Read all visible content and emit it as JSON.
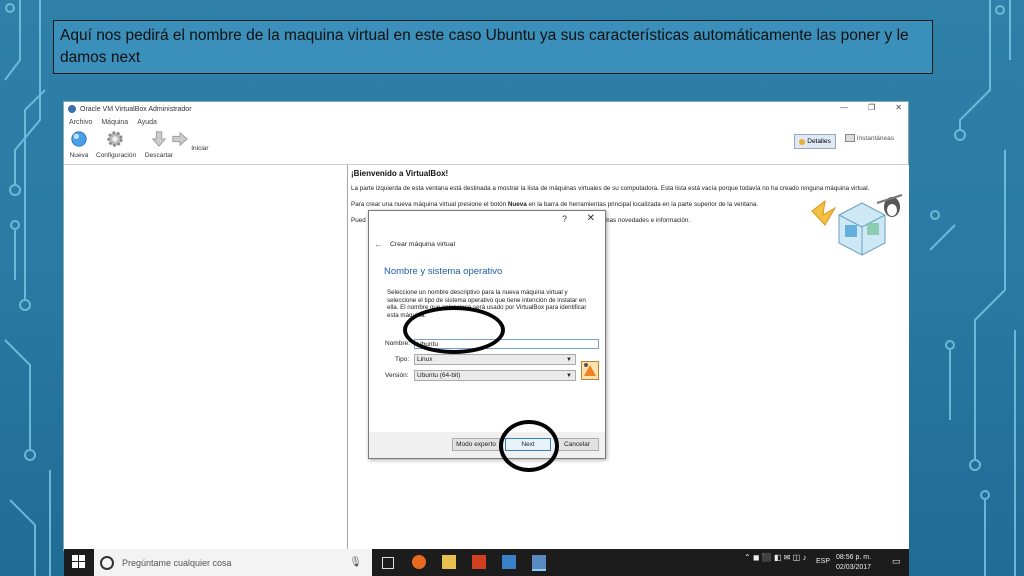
{
  "caption": "Aquí nos pedirá el nombre de la maquina virtual en este caso Ubuntu ya sus características automáticamente las poner y le damos next",
  "window": {
    "title": "Oracle VM VirtualBox Administrador",
    "menu": [
      "Archivo",
      "Máquina",
      "Ayuda"
    ],
    "toolbar": [
      "Nueva",
      "Configuración",
      "Descartar",
      "Iniciar"
    ],
    "detalles": "Detalles",
    "instantaneas": "Instantáneas"
  },
  "welcome": {
    "title": "¡Bienvenido a VirtualBox!",
    "p1": "La parte izquierda de esta ventana está destinada a mostrar la lista de máquinas virtuales de su computadora. Esta lista está vacía porque todavía no ha creado ninguna máquina virtual.",
    "p2_a": "Para crear una nueva máquina virtual presione el botón ",
    "p2_b": "Nueva",
    "p2_c": " en la barra de herramientas principal localizada en la parte superior de la ventana.",
    "p3_start": "Pued",
    "p3_end": "imas novedades e información."
  },
  "dialog": {
    "help": "?",
    "close": "✕",
    "back": "←",
    "title": "Crear máquina virtual",
    "section": "Nombre y sistema operativo",
    "description": "Seleccione un nombre descriptivo para la nueva máquina virtual y seleccione el tipo de sistema operativo que tiene intención de instalar en ella. El nombre que seleccione será usado por VirtualBox para identificar esta máquina.",
    "name_label": "Nombre:",
    "name_value": "Ubuntu",
    "type_label": "Tipo:",
    "type_value": "Linux",
    "version_label": "Versión:",
    "version_value": "Ubuntu (64-bit)",
    "btn_expert": "Modo experto",
    "btn_next": "Next",
    "btn_cancel": "Cancelar"
  },
  "taskbar": {
    "search_placeholder": "Pregúntame cualquier cosa",
    "lang": "ESP",
    "time": "08:56 p. m.",
    "date": "02/03/2017"
  }
}
